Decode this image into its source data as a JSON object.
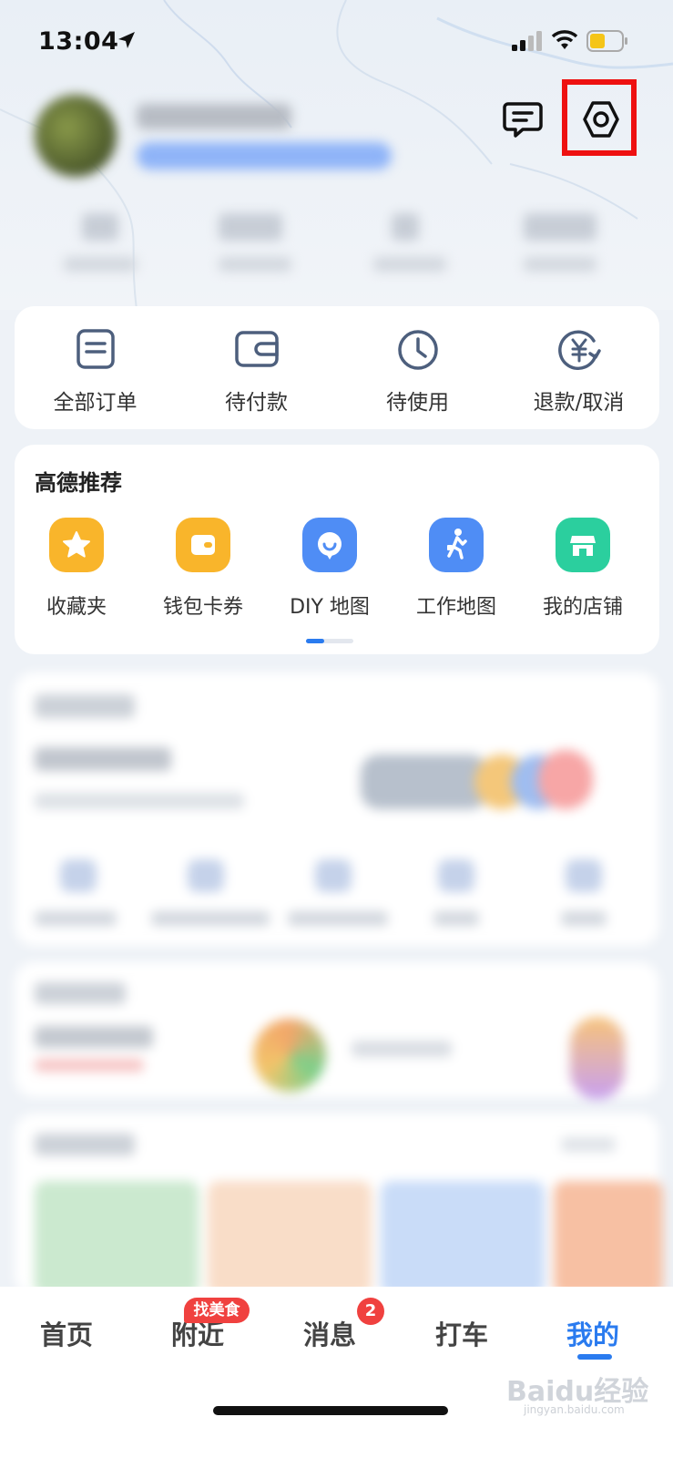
{
  "status_bar": {
    "time": "13:04"
  },
  "header": {
    "profile_name": "",
    "message_icon": "message-icon",
    "settings_icon": "settings-icon",
    "highlight_color": "#ee1111"
  },
  "orders": {
    "items": [
      {
        "label": "全部订单",
        "icon": "order-list-icon"
      },
      {
        "label": "待付款",
        "icon": "wallet-icon"
      },
      {
        "label": "待使用",
        "icon": "clock-icon"
      },
      {
        "label": "退款/取消",
        "icon": "yen-refund-icon"
      }
    ]
  },
  "recommend": {
    "title": "高德推荐",
    "items": [
      {
        "label": "收藏夹",
        "icon": "star-icon",
        "color": "#f9b52b"
      },
      {
        "label": "钱包卡券",
        "icon": "wallet-card-icon",
        "color": "#f9b52b"
      },
      {
        "label": "DIY 地图",
        "icon": "diy-map-icon",
        "color": "#4f8df5"
      },
      {
        "label": "工作地图",
        "icon": "walking-person-icon",
        "color": "#4f8df5"
      },
      {
        "label": "我的店铺",
        "icon": "store-icon",
        "color": "#2bcf9e"
      }
    ]
  },
  "tab_bar": {
    "tabs": [
      {
        "label": "首页"
      },
      {
        "label": "附近",
        "badge": "找美食"
      },
      {
        "label": "消息",
        "badge": "2"
      },
      {
        "label": "打车"
      },
      {
        "label": "我的",
        "active": true
      }
    ],
    "active_color": "#2a7bef"
  },
  "watermark": {
    "text": "Baidu经验",
    "sub": "jingyan.baidu.com"
  }
}
